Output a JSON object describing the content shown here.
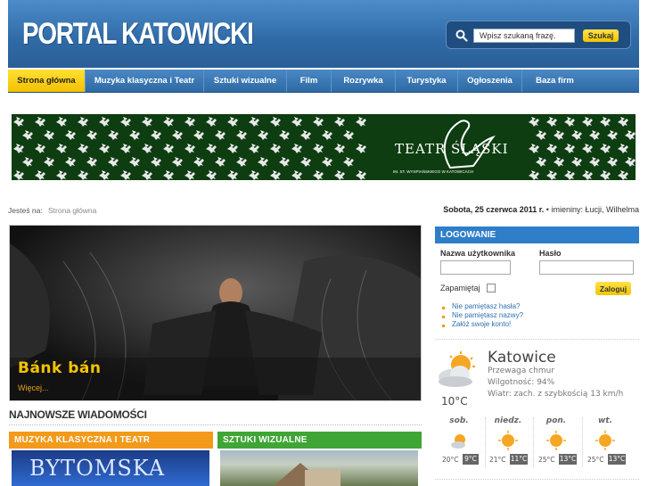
{
  "header": {
    "logo_text": "PORTAL KATOWICKI",
    "search": {
      "value": "Wpisz szukaną frazę.",
      "button_label": "Szukaj",
      "icon": "search-icon"
    }
  },
  "nav": {
    "items": [
      {
        "label": "Strona główna",
        "active": true
      },
      {
        "label": "Muzyka klasyczna i Teatr"
      },
      {
        "label": "Sztuki wizualne"
      },
      {
        "label": "Film"
      },
      {
        "label": "Rozrywka"
      },
      {
        "label": "Turystyka"
      },
      {
        "label": "Ogłoszenia"
      },
      {
        "label": "Baza firm"
      }
    ]
  },
  "banner": {
    "title": "TEATR ŚLĄSKI",
    "subtitle": "IM. ST. WYSPIAŃSKIEGO W KATOWICACH"
  },
  "breadcrumb": {
    "label": "Jesteś na:",
    "home": "Strona główna"
  },
  "date_line": {
    "date": "Sobota, 25 czerwca 2011 r.",
    "separator": "•",
    "namedays": "imieniny: Łucji, Wilhelma"
  },
  "featured": {
    "title": "Bánk bán",
    "more": "Więcej..."
  },
  "news": {
    "heading": "NAJNOWSZE WIADOMOŚCI",
    "categories": [
      {
        "label": "MUZYKA KLASYCZNA I TEATR",
        "color": "#f39a1a",
        "image_text": "BYTOMSKA"
      },
      {
        "label": "SZTUKI WIZUALNE",
        "color": "#3fa535"
      }
    ]
  },
  "login": {
    "heading": "LOGOWANIE",
    "username_label": "Nazwa użytkownika",
    "password_label": "Hasło",
    "remember_label": "Zapamiętaj",
    "button_label": "Zaloguj",
    "links": [
      "Nie pamiętasz hasła?",
      "Nie pamiętasz nazwy?",
      "Załóż swoje konto!"
    ]
  },
  "weather": {
    "city": "Katowice",
    "condition": "Przewaga chmur",
    "humidity": "Wilgotność: 94%",
    "wind": "Wiatr: zach. z szybkością 13 km/h",
    "temp": "10°C",
    "forecast": [
      {
        "day": "sob.",
        "low": "20°C",
        "high": "9°C"
      },
      {
        "day": "niedz.",
        "low": "21°C",
        "high": "11°C"
      },
      {
        "day": "pon.",
        "low": "25°C",
        "high": "13°C"
      },
      {
        "day": "wt.",
        "low": "25°C",
        "high": "13°C"
      }
    ]
  }
}
